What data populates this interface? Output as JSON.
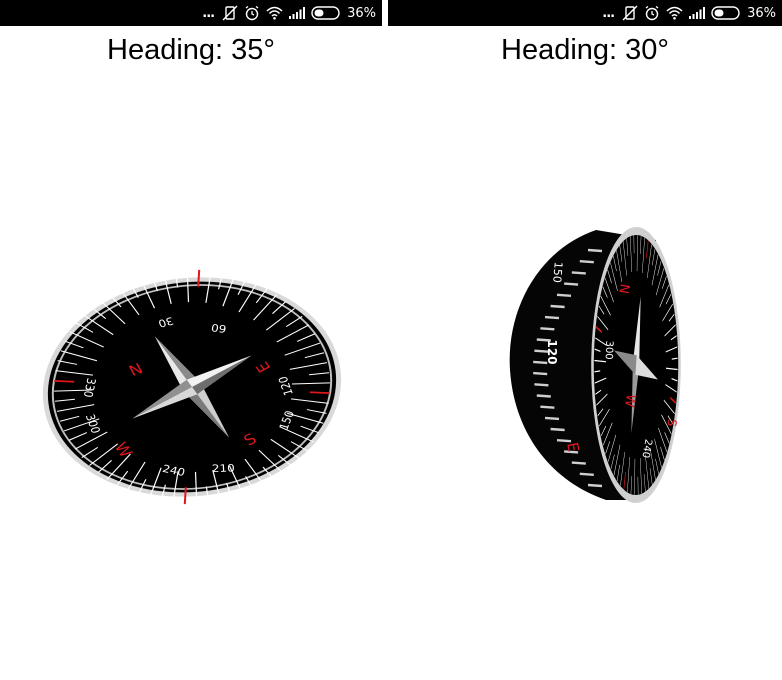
{
  "screens": [
    {
      "status_bar": {
        "dots": "...",
        "battery_percent": "36%"
      },
      "heading_text": "Heading: 35°",
      "compass": {
        "cardinals": {
          "n": "N",
          "e": "E",
          "s": "S",
          "w": "W"
        },
        "degree_labels": [
          "30",
          "60",
          "120",
          "150",
          "210",
          "240",
          "300",
          "330"
        ]
      }
    },
    {
      "status_bar": {
        "dots": "...",
        "battery_percent": "36%"
      },
      "heading_text": "Heading: 30°",
      "compass": {
        "cardinals": {
          "n": "N",
          "e": "E",
          "s": "S",
          "w": "W"
        },
        "degree_labels": [
          "120",
          "150",
          "240",
          "300"
        ]
      }
    }
  ],
  "colors": {
    "status_bar_bg": "#000000",
    "dial_bg": "#000000",
    "cardinal_red": "#e0161b",
    "tick_white": "#ffffff",
    "page_bg": "#ffffff"
  }
}
